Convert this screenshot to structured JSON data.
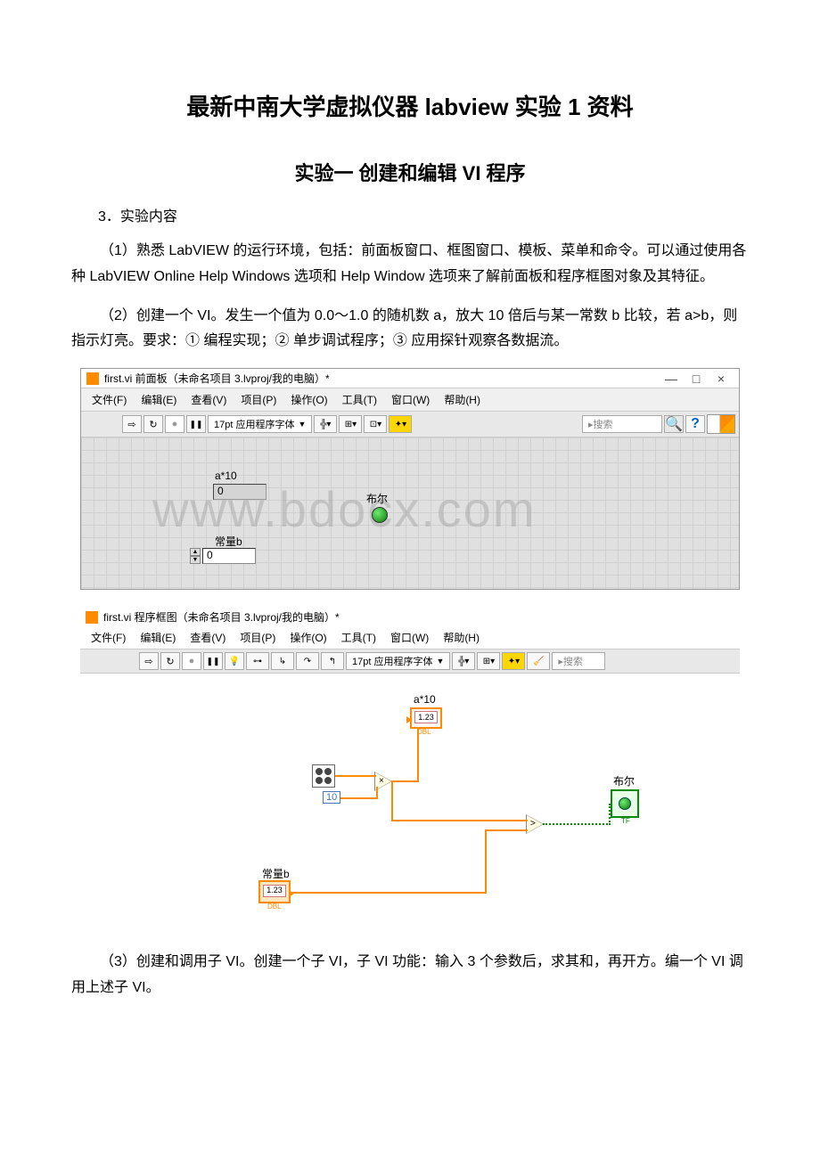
{
  "doc": {
    "title": "最新中南大学虚拟仪器 labview 实验 1 资料",
    "subtitle": "实验一 创建和编辑 VI 程序",
    "section3": "3．实验内容",
    "para1": "（1）熟悉 LabVIEW 的运行环境，包括：前面板窗口、框图窗口、模板、菜单和命令。可以通过使用各种 LabVIEW Online Help Windows 选项和 Help Window 选项来了解前面板和程序框图对象及其特征。",
    "para2": "（2）创建一个 VI。发生一个值为 0.0～1.0 的随机数 a，放大 10 倍后与某一常数 b 比较，若 a>b，则指示灯亮。要求：① 编程实现；② 单步调试程序；③ 应用探针观察各数据流。",
    "para3": "（3）创建和调用子 VI。创建一个子 VI，子 VI 功能：输入 3 个参数后，求其和，再开方。编一个 VI 调用上述子 VI。"
  },
  "fp": {
    "title": "first.vi 前面板（未命名项目 3.lvproj/我的电脑）*",
    "menus": [
      "文件(F)",
      "编辑(E)",
      "查看(V)",
      "项目(P)",
      "操作(O)",
      "工具(T)",
      "窗口(W)",
      "帮助(H)"
    ],
    "font": "17pt 应用程序字体",
    "search": "搜索",
    "help": "?",
    "label_a10": "a*10",
    "val_a10": "0",
    "label_bool": "布尔",
    "label_constb": "常量b",
    "val_constb": "0",
    "watermark": "www.bdocx.com",
    "winctrls": {
      "min": "—",
      "max": "□",
      "close": "×"
    }
  },
  "bd": {
    "title": "first.vi 程序框图（未命名项目 3.lvproj/我的电脑）*",
    "menus": [
      "文件(F)",
      "编辑(E)",
      "查看(V)",
      "项目(P)",
      "操作(O)",
      "工具(T)",
      "窗口(W)",
      "帮助(H)"
    ],
    "font": "17pt 应用程序字体",
    "search": "搜索",
    "label_a10": "a*10",
    "ind_val": "1.23",
    "const10": "10",
    "label_constb": "常量b",
    "ctrl_val": "1.23",
    "label_bool": "布尔",
    "mult_sym": "×",
    "gt_sym": ">",
    "dbl": "DBL",
    "tf": "TF"
  }
}
